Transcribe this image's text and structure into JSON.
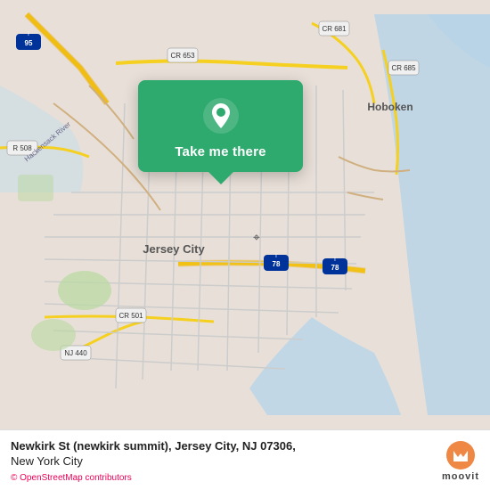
{
  "map": {
    "alt": "Street map of Jersey City and Hoboken, NJ area"
  },
  "card": {
    "label": "Take me there",
    "pin_alt": "location pin"
  },
  "bottom_bar": {
    "address_line1": "Newkirk St (newkirk summit), Jersey City, NJ 07306,",
    "address_line2": "New York City",
    "osm_credit": "© OpenStreetMap contributors",
    "moovit_label": "moovit"
  }
}
